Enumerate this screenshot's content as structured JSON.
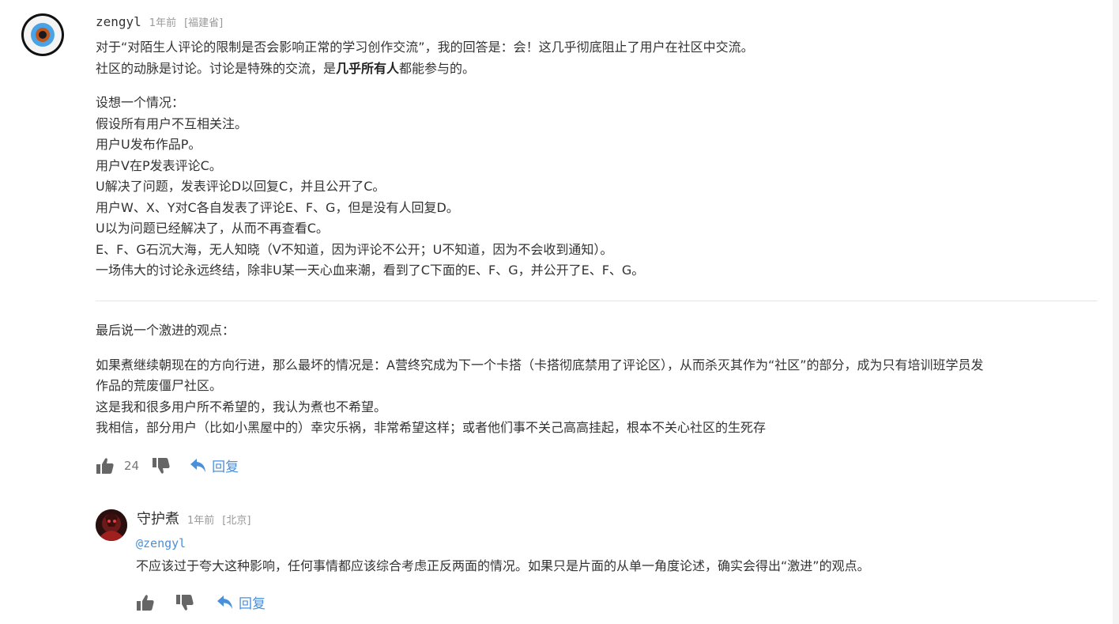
{
  "comment": {
    "username": "zengyl",
    "time": "1年前",
    "location": "[福建省]",
    "paragraph1": {
      "line1": "对于“对陌生人评论的限制是否会影响正常的学习创作交流”，我的回答是：会！这几乎彻底阻止了用户在社区中交流。",
      "line2_before": "社区的动脉是讨论。讨论是特殊的交流，是",
      "line2_bold": "几乎所有人",
      "line2_after": "都能参与的。"
    },
    "scenario": [
      "设想一个情况：",
      "假设所有用户不互相关注。",
      "用户U发布作品P。",
      "用户V在P发表评论C。",
      "U解决了问题，发表评论D以回复C，并且公开了C。",
      "用户W、X、Y对C各自发表了评论E、F、G，但是没有人回复D。",
      "U以为问题已经解决了，从而不再查看C。",
      "E、F、G石沉大海，无人知晓（V不知道，因为评论不公开；U不知道，因为不会收到通知）。",
      "一场伟大的讨论永远终结，除非U某一天心血来潮，看到了C下面的E、F、G，并公开了E、F、G。"
    ],
    "section2_title": "最后说一个激进的观点：",
    "section2": [
      "如果煮继续朝现在的方向行进，那么最坏的情况是：A营终究成为下一个卡搭（卡搭彻底禁用了评论区），从而杀灭其作为“社区”的部分，成为只有培训班学员发",
      "作品的荒废僵尸社区。",
      "这是我和很多用户所不希望的，我认为煮也不希望。",
      "我相信，部分用户（比如小黑屋中的）幸灾乐祸，非常希望这样；或者他们事不关己高高挂起，根本不关心社区的生死存"
    ],
    "likes": "24",
    "reply_label": "回复"
  },
  "reply": {
    "username": "守护煮",
    "time": "1年前",
    "location": "[北京]",
    "mention": "@zengyl",
    "text": "不应该过于夸大这种影响，任何事情都应该综合考虑正反两面的情况。如果只是片面的从单一角度论述，确实会得出“激进”的观点。",
    "reply_label": "回复"
  },
  "icons": {
    "like": "thumbs-up-icon",
    "dislike": "thumbs-down-icon",
    "reply": "reply-arrow-icon"
  },
  "colors": {
    "link": "#4a90d9",
    "meta": "#999999",
    "text": "#333333"
  }
}
